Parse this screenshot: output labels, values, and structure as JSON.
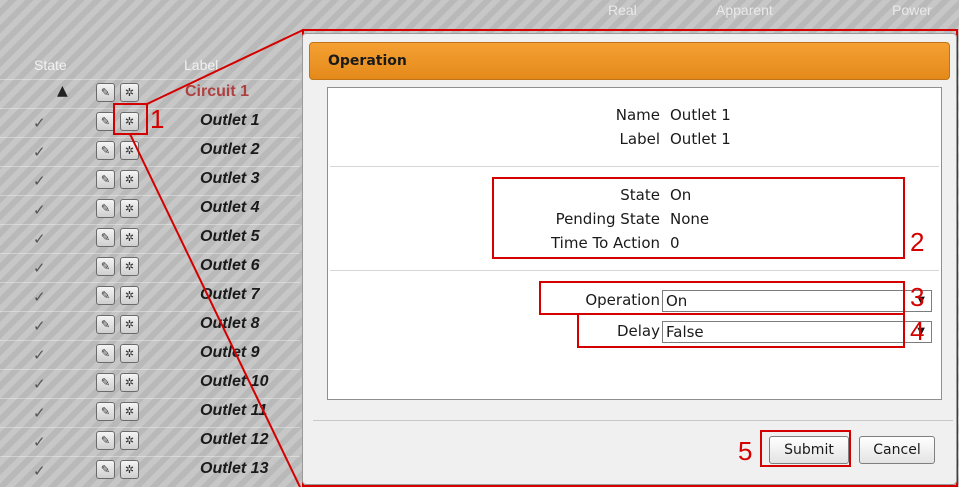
{
  "table": {
    "headers": {
      "state": "State",
      "label": "Label",
      "real": "Real",
      "apparent": "Apparent",
      "power": "Power"
    },
    "rows": [
      {
        "state": "▲",
        "label": "Circuit 1",
        "type": "circuit"
      },
      {
        "state": "✓",
        "label": "Outlet 1"
      },
      {
        "state": "✓",
        "label": "Outlet 2"
      },
      {
        "state": "✓",
        "label": "Outlet 3"
      },
      {
        "state": "✓",
        "label": "Outlet 4"
      },
      {
        "state": "✓",
        "label": "Outlet 5"
      },
      {
        "state": "✓",
        "label": "Outlet 6"
      },
      {
        "state": "✓",
        "label": "Outlet 7"
      },
      {
        "state": "✓",
        "label": "Outlet 8"
      },
      {
        "state": "✓",
        "label": "Outlet 9"
      },
      {
        "state": "✓",
        "label": "Outlet 10"
      },
      {
        "state": "✓",
        "label": "Outlet 11"
      },
      {
        "state": "✓",
        "label": "Outlet 12"
      },
      {
        "state": "✓",
        "label": "Outlet 13"
      }
    ],
    "icons": {
      "wrench": "wrench-icon",
      "gear": "gear-icon",
      "warning": "warning-icon",
      "check": "check-icon"
    }
  },
  "dialog": {
    "title": "Operation",
    "info": {
      "name_key": "Name",
      "name_val": "Outlet 1",
      "label_key": "Label",
      "label_val": "Outlet 1"
    },
    "status": {
      "state_key": "State",
      "state_val": "On",
      "pending_key": "Pending State",
      "pending_val": "None",
      "tta_key": "Time To Action",
      "tta_val": "0"
    },
    "form": {
      "operation_label": "Operation",
      "operation_value": "On",
      "delay_label": "Delay",
      "delay_value": "False"
    },
    "buttons": {
      "submit": "Submit",
      "cancel": "Cancel"
    }
  },
  "annotations": [
    "1",
    "2",
    "3",
    "4",
    "5"
  ],
  "colors": {
    "title_bar": "#e48a1b",
    "annotation": "#d40000"
  }
}
